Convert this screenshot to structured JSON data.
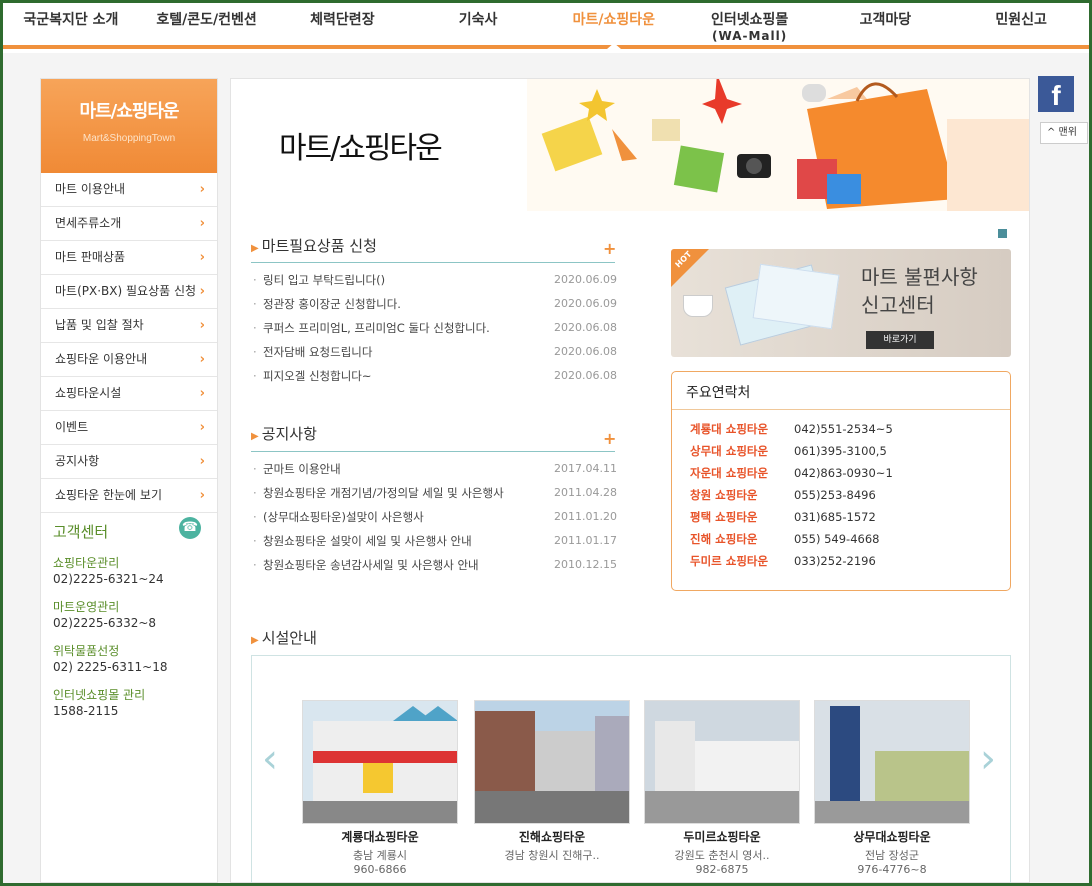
{
  "topnav": {
    "items": [
      {
        "label": "국군복지단 소개",
        "sub": ""
      },
      {
        "label": "호텔/콘도/컨벤션",
        "sub": ""
      },
      {
        "label": "체력단련장",
        "sub": ""
      },
      {
        "label": "기숙사",
        "sub": ""
      },
      {
        "label": "마트/쇼핑타운",
        "sub": ""
      },
      {
        "label": "인터넷쇼핑몰",
        "sub": "(WA-Mall)"
      },
      {
        "label": "고객마당",
        "sub": ""
      },
      {
        "label": "민원신고",
        "sub": ""
      }
    ],
    "active_index": 4
  },
  "sidebar": {
    "title": "마트/쇼핑타운",
    "subtitle": "Mart&ShoppingTown",
    "items": [
      {
        "label": "마트 이용안내"
      },
      {
        "label": "면세주류소개"
      },
      {
        "label": "마트 판매상품"
      },
      {
        "label": "마트(PX·BX) 필요상품 신청"
      },
      {
        "label": "납품 및 입찰 절차"
      },
      {
        "label": "쇼핑타운 이용안내"
      },
      {
        "label": "쇼핑타운시설"
      },
      {
        "label": "이벤트"
      },
      {
        "label": "공지사항"
      },
      {
        "label": "쇼핑타운 한눈에 보기"
      }
    ],
    "chevron": "›",
    "customer_center": {
      "title": "고객센터",
      "entries": [
        {
          "name": "쇼핑타운관리",
          "phone": "02)2225-6321~24"
        },
        {
          "name": "마트운영관리",
          "phone": "02)2225-6332~8"
        },
        {
          "name": "위탁물품선정",
          "phone": "02) 2225-6311~18"
        },
        {
          "name": "인터넷쇼핑몰 관리",
          "phone": "1588-2115"
        }
      ]
    }
  },
  "main": {
    "title": "마트/쇼핑타운",
    "request_section": {
      "title": "마트필요상품 신청",
      "items": [
        {
          "text": "링티 입고 부탁드립니다()",
          "date": "2020.06.09"
        },
        {
          "text": "정관장 홍이장군 신청합니다.",
          "date": "2020.06.09"
        },
        {
          "text": "쿠퍼스 프리미엄L, 프리미엄C 둘다 신청합니다.",
          "date": "2020.06.08"
        },
        {
          "text": "전자담배 요청드립니다",
          "date": "2020.06.08"
        },
        {
          "text": "피지오겔 신청합니다~",
          "date": "2020.06.08"
        }
      ]
    },
    "notice_section": {
      "title": "공지사항",
      "items": [
        {
          "text": "군마트 이용안내",
          "date": "2017.04.11"
        },
        {
          "text": "창원쇼핑타운 개점기념/가정의달 세일 및 사은행사",
          "date": "2011.04.28"
        },
        {
          "text": "(상무대쇼핑타운)설맞이 사은행사",
          "date": "2011.01.20"
        },
        {
          "text": "창원쇼핑타운 설맞이 세일 및 사은행사 안내",
          "date": "2011.01.17"
        },
        {
          "text": "창원쇼핑타운 송년감사세일 및 사은행사 안내",
          "date": "2010.12.15"
        }
      ]
    },
    "plus": "+",
    "complaint_banner": {
      "hot": "HOT",
      "line1": "마트 불편사항",
      "line2": "신고센터",
      "button": "바로가기"
    },
    "contacts": {
      "title": "주요연락처",
      "rows": [
        {
          "name": "계룡대 쇼핑타운",
          "phone": "042)551-2534~5"
        },
        {
          "name": "상무대 쇼핑타운",
          "phone": "061)395-3100,5"
        },
        {
          "name": "자운대 쇼핑타운",
          "phone": "042)863-0930~1"
        },
        {
          "name": "창원 쇼핑타운",
          "phone": "055)253-8496"
        },
        {
          "name": "평택 쇼핑타운",
          "phone": "031)685-1572"
        },
        {
          "name": "진해 쇼핑타운",
          "phone": "055) 549-4668"
        },
        {
          "name": "두미르 쇼핑타운",
          "phone": "033)252-2196"
        }
      ]
    },
    "facility": {
      "title": "시설안내",
      "prev": "‹",
      "next": "›",
      "cards": [
        {
          "name": "계룡대쇼핑타운",
          "addr": "충남 계룡시",
          "phone": "960-6866"
        },
        {
          "name": "진해쇼핑타운",
          "addr": "경남 창원시 진해구..",
          "phone": ""
        },
        {
          "name": "두미르쇼핑타운",
          "addr": "강원도 춘천시 영서..",
          "phone": "982-6875"
        },
        {
          "name": "상무대쇼핑타운",
          "addr": "전남 장성군",
          "phone": "976-4776~8"
        }
      ]
    }
  },
  "right": {
    "facebook": "f",
    "top_button": "^ 맨위"
  },
  "colors": {
    "accent": "#f0913d",
    "green": "#5a8e2a",
    "contact_name": "#e8542a",
    "facebook": "#3b5998"
  }
}
